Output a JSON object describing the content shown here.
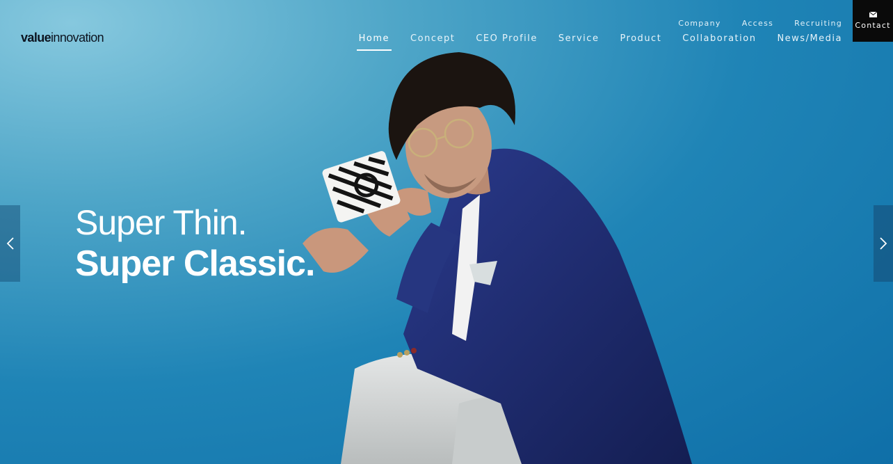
{
  "brand": {
    "logo_bold": "value",
    "logo_light": "innovation"
  },
  "subnav": [
    "Company",
    "Access",
    "Recruiting"
  ],
  "mainnav": {
    "active": "Home",
    "items": [
      "Home",
      "Concept",
      "CEO Profile",
      "Service",
      "Product",
      "Collaboration",
      "News/Media"
    ]
  },
  "contact": {
    "label": "Contact",
    "icon": "mail-icon"
  },
  "hero": {
    "line1": "Super Thin.",
    "line2": "Super Classic."
  },
  "slider": {
    "prev_icon": "chevron-left-icon",
    "next_icon": "chevron-right-icon"
  },
  "colors": {
    "background_light": "#86c8de",
    "background_dark": "#0f6fa8",
    "contact_bg": "#0a0a0a",
    "text": "#ffffff"
  }
}
